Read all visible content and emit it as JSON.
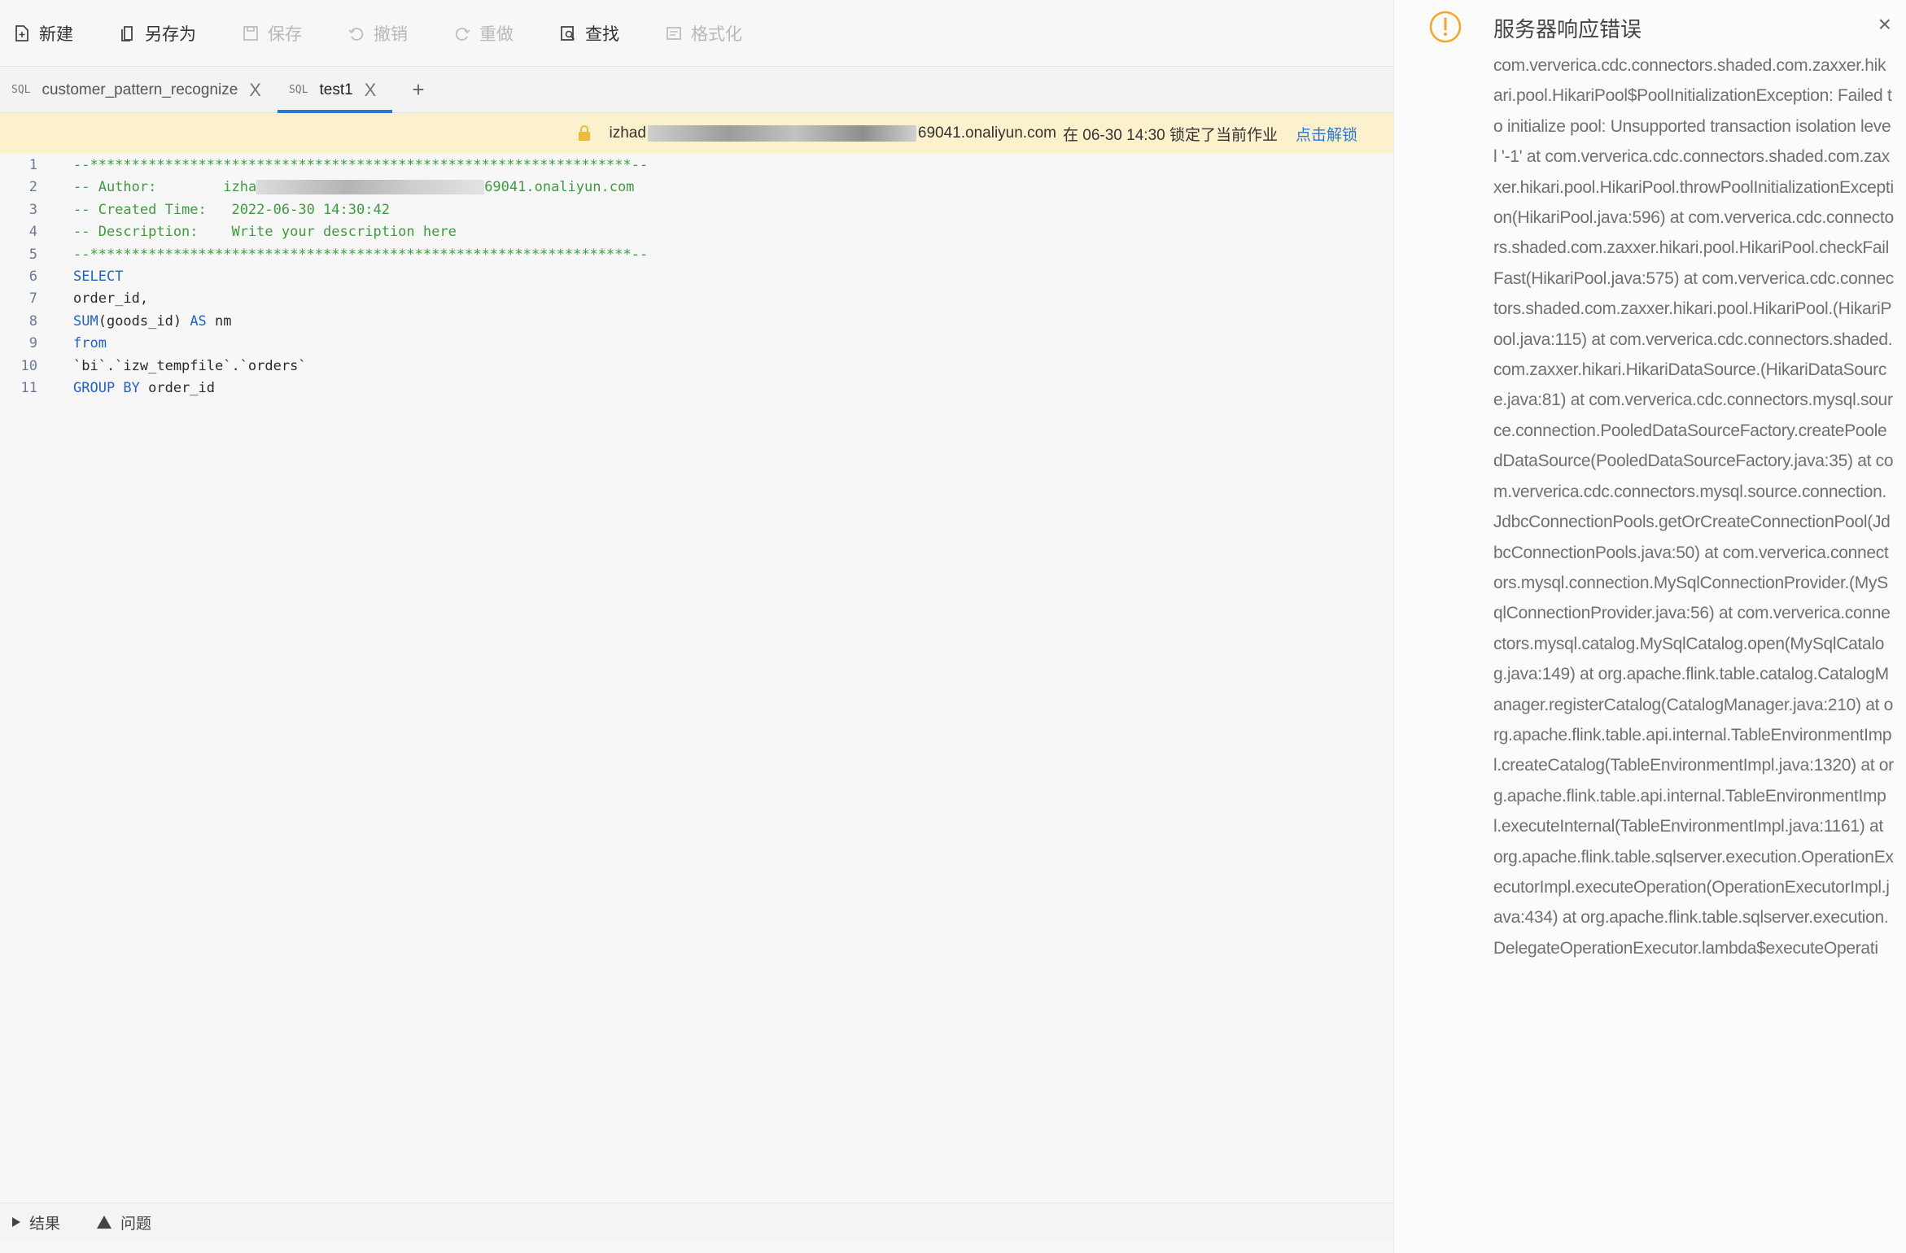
{
  "toolbar": {
    "new": "新建",
    "save_as": "另存为",
    "save": "保存",
    "undo": "撤销",
    "redo": "重做",
    "find": "查找",
    "format": "格式化"
  },
  "tabs": [
    {
      "icon": "SQL",
      "label": "customer_pattern_recognize",
      "close": "X"
    },
    {
      "icon": "SQL",
      "label": "test1",
      "close": "X"
    }
  ],
  "tab_add": "+",
  "lock_bar": {
    "user_prefix": "izhad",
    "user_suffix": "69041.onaliyun.com",
    "message": "在 06-30 14:30 锁定了当前作业",
    "unlock": "点击解锁"
  },
  "code": {
    "line_numbers": [
      "1",
      "2",
      "3",
      "4",
      "5",
      "6",
      "7",
      "8",
      "9",
      "10",
      "11"
    ],
    "rule": "--*****************************************************************--",
    "author_label": "-- Author:        ",
    "author_prefix": "izha",
    "author_suffix": "69041.onaliyun.com",
    "created_line": "-- Created Time:   2022-06-30 14:30:42",
    "description_line": "-- Description:    Write your description here",
    "select_kw": "SELECT",
    "order_id_line": "order_id,",
    "sum_kw": "SUM",
    "sum_arg": "(goods_id) ",
    "as_kw": "AS",
    "alias": " nm",
    "from_kw": "from",
    "table_ref": "`bi`.`izw_tempfile`.`orders`",
    "group_kw": "GROUP BY",
    "group_col": " order_id"
  },
  "bottom_bar": {
    "results": "结果",
    "problems": "问题"
  },
  "notification": {
    "title": "服务器响应错误",
    "close": "×",
    "message": "com.ververica.cdc.connectors.shaded.com.zaxxer.hikari.pool.HikariPool$PoolInitializationException: Failed to initialize pool: Unsupported transaction isolation level '-1' at com.ververica.cdc.connectors.shaded.com.zaxxer.hikari.pool.HikariPool.throwPoolInitializationException(HikariPool.java:596) at com.ververica.cdc.connectors.shaded.com.zaxxer.hikari.pool.HikariPool.checkFailFast(HikariPool.java:575) at com.ververica.cdc.connectors.shaded.com.zaxxer.hikari.pool.HikariPool.(HikariPool.java:115) at com.ververica.cdc.connectors.shaded.com.zaxxer.hikari.HikariDataSource.(HikariDataSource.java:81) at com.ververica.cdc.connectors.mysql.source.connection.PooledDataSourceFactory.createPooledDataSource(PooledDataSourceFactory.java:35) at com.ververica.cdc.connectors.mysql.source.connection.JdbcConnectionPools.getOrCreateConnectionPool(JdbcConnectionPools.java:50) at com.ververica.connectors.mysql.connection.MySqlConnectionProvider.(MySqlConnectionProvider.java:56) at com.ververica.connectors.mysql.catalog.MySqlCatalog.open(MySqlCatalog.java:149) at org.apache.flink.table.catalog.CatalogManager.registerCatalog(CatalogManager.java:210) at org.apache.flink.table.api.internal.TableEnvironmentImpl.createCatalog(TableEnvironmentImpl.java:1320) at org.apache.flink.table.api.internal.TableEnvironmentImpl.executeInternal(TableEnvironmentImpl.java:1161) at org.apache.flink.table.sqlserver.execution.OperationExecutorImpl.executeOperation(OperationExecutorImpl.java:434) at org.apache.flink.table.sqlserver.execution.DelegateOperationExecutor.lambda$executeOperati"
  },
  "colors": {
    "accent": "#2a78d6",
    "lock_bar_bg": "#fbf1cd",
    "comment": "#3d9d3d",
    "keyword": "#1f62d0",
    "warning": "#f5a623"
  }
}
